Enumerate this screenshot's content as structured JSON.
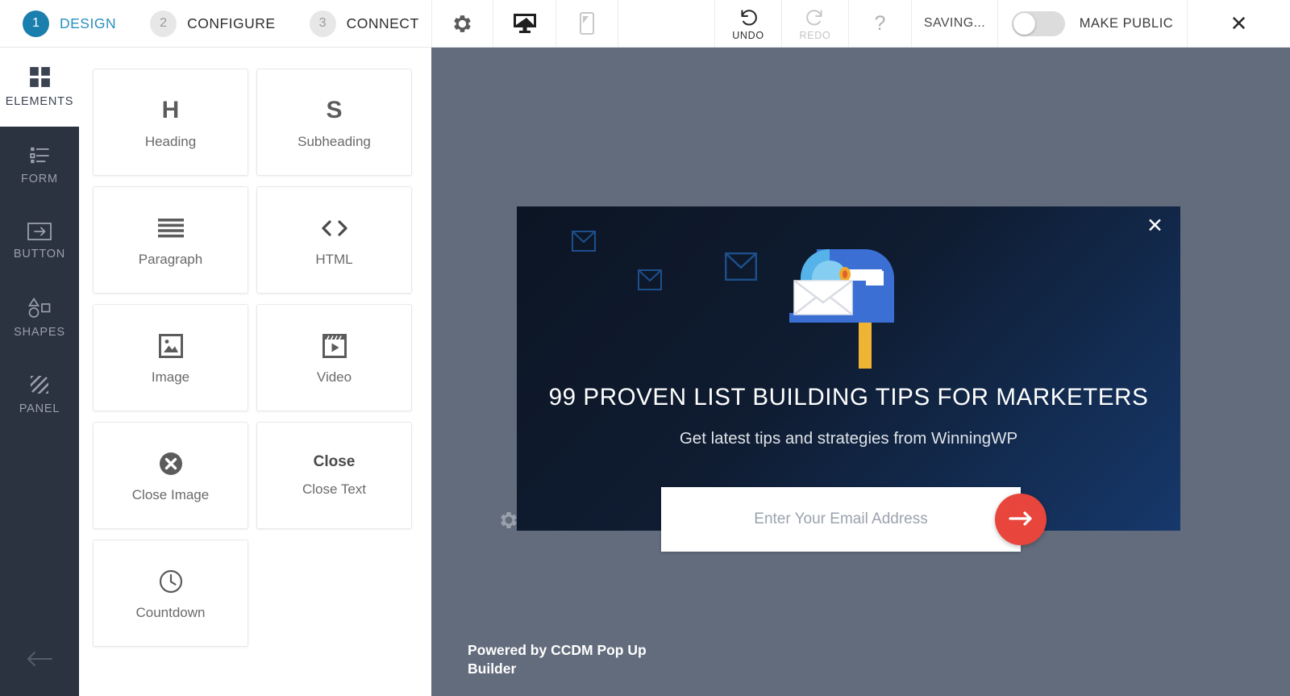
{
  "steps": [
    {
      "num": "1",
      "label": "DESIGN",
      "state": "active"
    },
    {
      "num": "2",
      "label": "CONFIGURE",
      "state": "inactive"
    },
    {
      "num": "3",
      "label": "CONNECT",
      "state": "inactive"
    }
  ],
  "toolbar": {
    "gear_icon": "gear-icon",
    "desktop_icon": "desktop-preview-icon",
    "mobile_icon": "mobile-preview-icon",
    "undo_label": "UNDO",
    "redo_label": "REDO",
    "help_label": "?",
    "saving_label": "SAVING...",
    "make_public_label": "MAKE PUBLIC",
    "make_public_on": false,
    "close_label": "✕"
  },
  "rail": {
    "items": [
      {
        "label": "ELEMENTS",
        "icon": "grid-icon",
        "active": true
      },
      {
        "label": "FORM",
        "icon": "form-list-icon",
        "active": false
      },
      {
        "label": "BUTTON",
        "icon": "button-arrow-icon",
        "active": false
      },
      {
        "label": "SHAPES",
        "icon": "shapes-icon",
        "active": false
      },
      {
        "label": "PANEL",
        "icon": "panel-hatch-icon",
        "active": false
      }
    ],
    "back_icon": "back-arrow-icon"
  },
  "elements": [
    {
      "glyph": "H",
      "label": "Heading",
      "icon": "heading-icon"
    },
    {
      "glyph": "S",
      "label": "Subheading",
      "icon": "subheading-icon"
    },
    {
      "glyph": "☰",
      "label": "Paragraph",
      "icon": "paragraph-icon"
    },
    {
      "glyph": "<>",
      "label": "HTML",
      "icon": "html-code-icon"
    },
    {
      "glyph": "",
      "label": "Image",
      "icon": "image-icon"
    },
    {
      "glyph": "",
      "label": "Video",
      "icon": "video-icon"
    },
    {
      "glyph": "",
      "label": "Close Image",
      "icon": "close-circle-icon"
    },
    {
      "glyph": "Close",
      "label": "Close Text",
      "icon": "close-text-icon"
    },
    {
      "glyph": "",
      "label": "Countdown",
      "icon": "clock-icon"
    }
  ],
  "canvas": {
    "gear_icon": "canvas-gear-icon",
    "powered_by": "Powered by CCDM Pop Up Builder"
  },
  "popup": {
    "close_label": "✕",
    "title": "99 PROVEN LIST BUILDING TIPS FOR MARKETERS",
    "subtitle": "Get latest tips and strategies from WinningWP",
    "email_placeholder": "Enter Your Email Address",
    "email_value": "",
    "submit_icon": "arrow-right-icon",
    "hero_icon": "mailbox-envelopes-illustration"
  },
  "colors": {
    "accent_blue": "#1b7fad",
    "rail_dark": "#2b3240",
    "canvas_gray": "#636c7c",
    "popup_navy": "#0f1c31",
    "popup_blue": "#16386b",
    "submit_red": "#e8453c",
    "mailbox_blue": "#3b6fd4",
    "mailbox_yellow": "#f0b434"
  }
}
